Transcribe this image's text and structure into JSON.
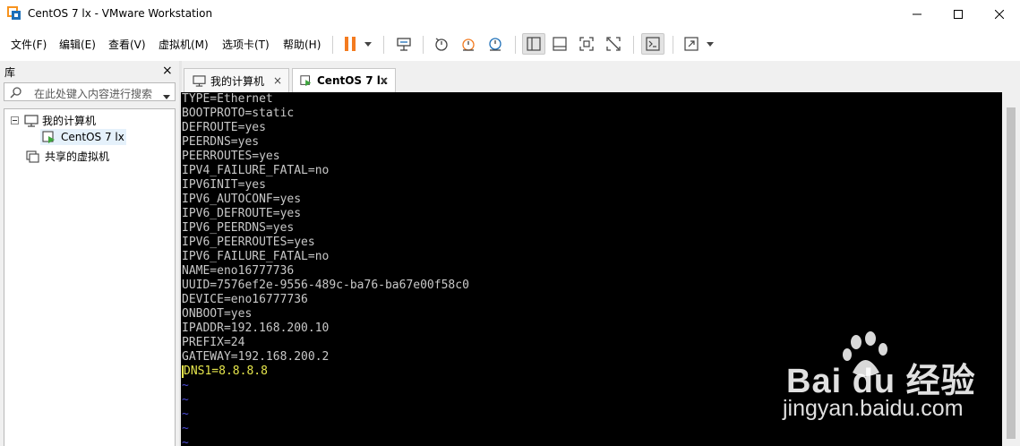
{
  "window": {
    "title": "CentOS 7 lx - VMware Workstation"
  },
  "menu": {
    "file": "文件(F)",
    "edit": "编辑(E)",
    "view": "查看(V)",
    "vm": "虚拟机(M)",
    "tabs": "选项卡(T)",
    "help": "帮助(H)"
  },
  "toolbar": {
    "icons": [
      "pause-icon",
      "dropdown-arrow-icon",
      "send-ctrl-alt-del-icon",
      "snapshot-icon",
      "revert-snapshot-icon",
      "snapshot-manager-icon",
      "show-library-icon",
      "thumbnail-bar-icon",
      "full-screen-icon",
      "unity-icon",
      "console-view-icon",
      "stretch-icon",
      "dropdown-arrow-icon"
    ]
  },
  "library": {
    "title": "库",
    "close": "×",
    "search_placeholder": "在此处键入内容进行搜索",
    "tree": {
      "my_computer": "我的计算机",
      "vm": "CentOS 7 lx",
      "shared": "共享的虚拟机"
    }
  },
  "tabs": [
    {
      "label": "我的计算机",
      "close": "×"
    },
    {
      "label": "CentOS 7 lx",
      "close": "×"
    }
  ],
  "console": {
    "lines": [
      "TYPE=Ethernet",
      "BOOTPROTO=static",
      "DEFROUTE=yes",
      "PEERDNS=yes",
      "PEERROUTES=yes",
      "IPV4_FAILURE_FATAL=no",
      "IPV6INIT=yes",
      "IPV6_AUTOCONF=yes",
      "IPV6_DEFROUTE=yes",
      "IPV6_PEERDNS=yes",
      "IPV6_PEERROUTES=yes",
      "IPV6_FAILURE_FATAL=no",
      "NAME=eno16777736",
      "UUID=7576ef2e-9556-489c-ba76-ba67e00f58c0",
      "DEVICE=eno16777736",
      "ONBOOT=yes",
      "IPADDR=192.168.200.10",
      "PREFIX=24",
      "GATEWAY=192.168.200.2"
    ],
    "active_line": "DNS1=8.8.8.8",
    "tildes": [
      "~",
      "~",
      "~",
      "~",
      "~"
    ],
    "colors": {
      "text": "#c8c8c8",
      "active": "#e5e54c",
      "tilde": "#4b4bd6",
      "bg": "#000000"
    }
  },
  "watermark": {
    "brand": "Bai du 经验",
    "url": "jingyan.baidu.com"
  }
}
